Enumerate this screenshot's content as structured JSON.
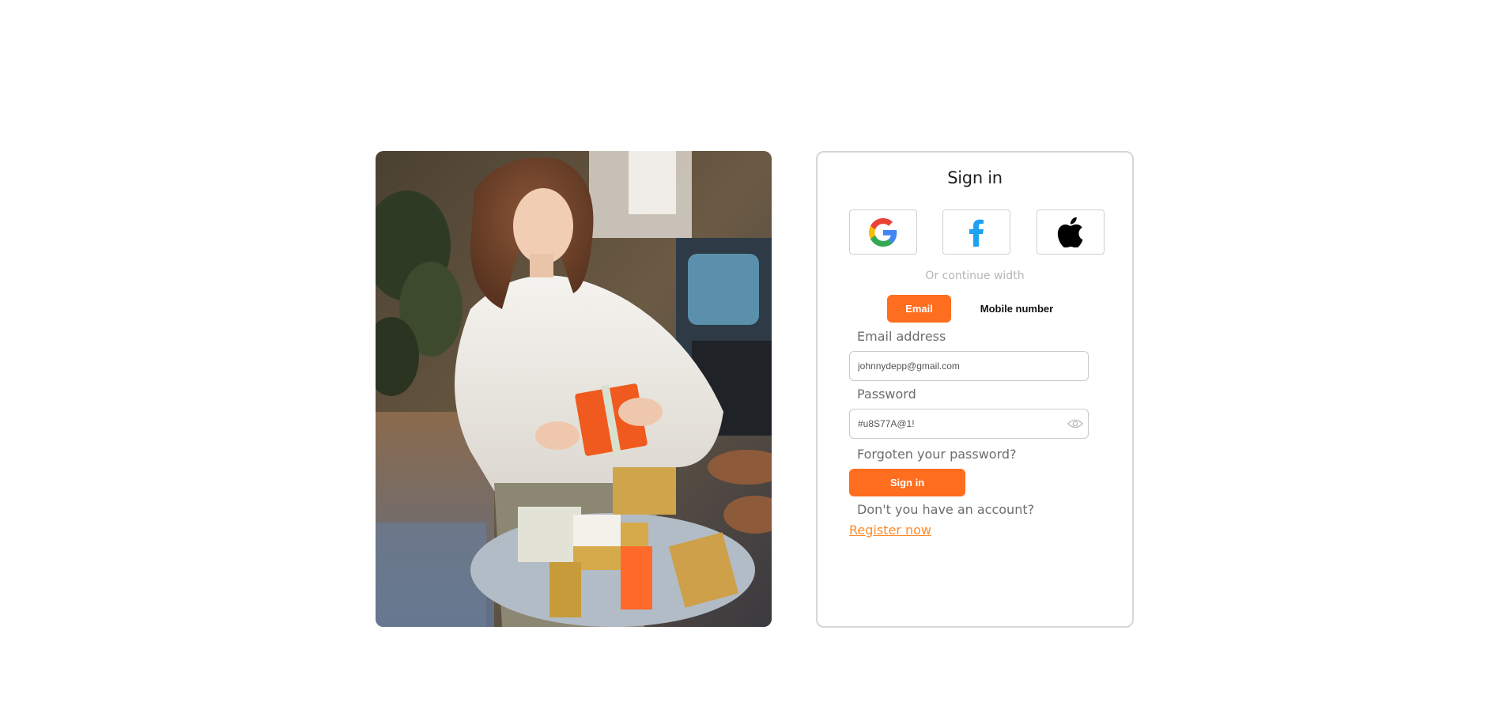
{
  "photo": {
    "icon": "photo-woman-wrapping-gifts"
  },
  "signin": {
    "title": "Sign in",
    "social": [
      {
        "name": "Google",
        "icon": "google-icon"
      },
      {
        "name": "Facebook",
        "icon": "facebook-icon"
      },
      {
        "name": "Apple",
        "icon": "apple-icon"
      }
    ],
    "divider_text": "Or continue width",
    "tabs": {
      "email_label": "Email",
      "mobile_label": "Mobile number",
      "active": "Email"
    },
    "email": {
      "label": "Email address",
      "value": "johnnydepp@gmail.com"
    },
    "password": {
      "label": "Password",
      "value": "#u8S77A@1!"
    },
    "forgot_label": "Forgoten your password?",
    "submit_label": "Sign in",
    "no_account_text": "Don't you have an account?",
    "register_label": "Register now"
  },
  "colors": {
    "accent": "#ff6d1f",
    "link": "#ff8a2a",
    "border": "#d6d6d6",
    "muted_text": "#6d6d6d",
    "facebook_blue": "#1da1f2"
  }
}
